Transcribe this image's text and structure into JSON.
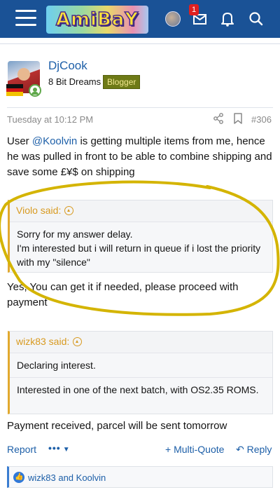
{
  "header": {
    "logo_text": "AmiBaY",
    "notification_count": "1",
    "icons": [
      "menu-icon",
      "user-avatar",
      "mail-icon",
      "bell-icon",
      "search-icon"
    ],
    "bar_color": "#1a5296"
  },
  "post": {
    "username": "DjCook",
    "user_title": "8 Bit Dreams",
    "role_badge": "Blogger",
    "date": "Tuesday at 10:12 PM",
    "post_number": "#306",
    "intro": {
      "before": "User ",
      "mention": "@Koolvin",
      "after": " is getting multiple items from me, hence he was pulled in front to be able to combine shipping and save some £¥$ on shipping"
    },
    "quote1": {
      "author": "Violo said:",
      "text": "Sorry for my answer delay.\nI'm interested but i will return in queue if i lost the priority with my \"silence\""
    },
    "reply1": "Yes, You can get it if needed, please proceed with payment",
    "quote2": {
      "author": "wizk83 said:",
      "text1": "Declaring interest.",
      "text2": "Interested in one of the next batch, with OS2.35 ROMS."
    },
    "reply2": "Payment received, parcel will be sent tomorrow",
    "actions": {
      "report": "Report",
      "more": "•••",
      "multi_quote": "+ Multi-Quote",
      "reply": "Reply"
    },
    "reactions": "wizk83 and Koolvin"
  },
  "colors": {
    "link": "#1d5fa8",
    "quote_accent": "#e2a92e",
    "badge_bg": "#6e7a16",
    "annotation": "#d4b400"
  }
}
